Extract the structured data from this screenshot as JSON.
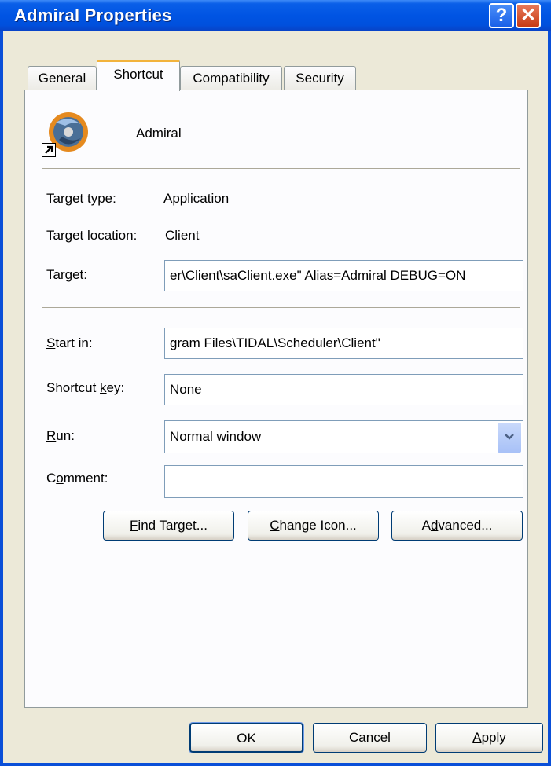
{
  "window": {
    "title": "Admiral Properties",
    "help_glyph": "?",
    "close_glyph": "✕"
  },
  "tabs": [
    {
      "label": "General"
    },
    {
      "label": "Shortcut"
    },
    {
      "label": "Compatibility"
    },
    {
      "label": "Security"
    }
  ],
  "shortcut": {
    "name": "Admiral",
    "target_type_label": "Target type:",
    "target_type_value": "Application",
    "target_location_label": "Target location:",
    "target_location_value": "Client",
    "target": {
      "label_u": "T",
      "label_rest": "arget:",
      "value": "er\\Client\\saClient.exe\" Alias=Admiral DEBUG=ON"
    },
    "start_in": {
      "label_u": "S",
      "label_rest": "tart in:",
      "value": "gram Files\\TIDAL\\Scheduler\\Client\""
    },
    "shortcut_key": {
      "label_pre": "Shortcut ",
      "label_u": "k",
      "label_rest": "ey:",
      "value": "None"
    },
    "run": {
      "label_u": "R",
      "label_rest": "un:",
      "value": "Normal window"
    },
    "comment": {
      "label_pre": "C",
      "label_u": "o",
      "label_rest": "mment:",
      "value": ""
    },
    "buttons": {
      "find_target": {
        "u": "F",
        "rest": "ind Target..."
      },
      "change_icon": {
        "u": "C",
        "rest": "hange Icon..."
      },
      "advanced": {
        "pre": "A",
        "u": "d",
        "rest": "vanced..."
      }
    }
  },
  "dialog_buttons": {
    "ok": "OK",
    "cancel": "Cancel",
    "apply": {
      "u": "A",
      "rest": "pply"
    }
  },
  "colors": {
    "title_bar": "#0054e3",
    "dialog_bg": "#ece9d8",
    "active_tab_accent": "#f2b33c",
    "field_border": "#7f9db9"
  }
}
